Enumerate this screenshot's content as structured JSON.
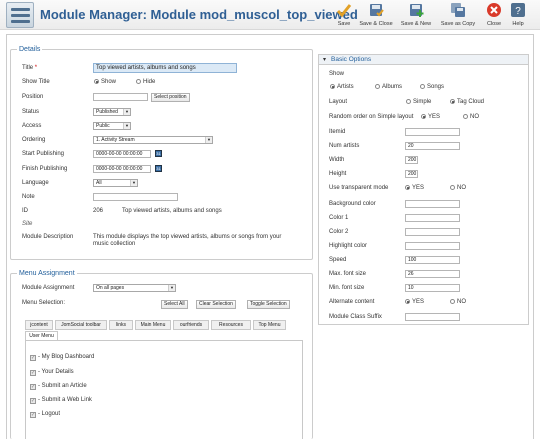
{
  "header": {
    "title": "Module Manager: Module mod_muscol_top_viewed",
    "toolbar": [
      {
        "label": "Save",
        "icon": "check-icon",
        "color": "#e2a127"
      },
      {
        "label": "Save & Close",
        "icon": "disk-check-icon",
        "color": "#5577a0"
      },
      {
        "label": "Save & New",
        "icon": "disk-plus-icon",
        "color": "#5577a0"
      },
      {
        "label": "Save as Copy",
        "icon": "disk-copy-icon",
        "color": "#5577a0"
      },
      {
        "label": "Close",
        "icon": "close-icon",
        "color": "#d93a2a"
      },
      {
        "label": "Help",
        "icon": "help-icon",
        "color": "#4f6f8f"
      }
    ]
  },
  "details": {
    "legend": "Details",
    "title_label": "Title",
    "title_required": "*",
    "title_value": "Top viewed artists, albums and songs",
    "show_title_label": "Show Title",
    "show_title_options": [
      "Show",
      "Hide"
    ],
    "position_label": "Position",
    "position_value": "",
    "select_position_button": "Select position",
    "status_label": "Status",
    "status_value": "Published",
    "access_label": "Access",
    "access_value": "Public",
    "ordering_label": "Ordering",
    "ordering_value": "1. Activity Stream",
    "start_publishing_label": "Start Publishing",
    "start_publishing_value": "0000-00-00 00:00:00",
    "finish_publishing_label": "Finish Publishing",
    "finish_publishing_value": "0000-00-00 00:00:00",
    "language_label": "Language",
    "language_value": "All",
    "note_label": "Note",
    "note_value": "",
    "id_label": "ID",
    "id_value": "206",
    "id_desc": "Top viewed artists, albums and songs",
    "site_label": "Site",
    "module_description_label": "Module Description",
    "module_description_line1": "This module displays the top viewed artists, albums or songs from your",
    "module_description_line2": "music collection"
  },
  "menu_assignment": {
    "legend": "Menu Assignment",
    "module_assignment_label": "Module Assignment",
    "module_assignment_value": "On all pages",
    "menu_selection_label": "Menu Selection:",
    "select_all": "Select All",
    "clear_selection": "Clear Selection",
    "toggle_selection": "Toggle Selection",
    "tabs": [
      "jcontent",
      "JomSocial toolbar",
      "links",
      "Main Menu",
      "ourfriends",
      "Resources",
      "Top Menu"
    ],
    "active_tab": "User Menu",
    "items": [
      "- My Blog Dashboard",
      "- Your Details",
      "- Submit an Article",
      "- Submit a Web Link",
      "- Logout"
    ]
  },
  "basic_options": {
    "legend": "Basic Options",
    "show_label": "Show",
    "show_options": [
      "Artists",
      "Albums",
      "Songs"
    ],
    "layout_label": "Layout",
    "layout_options": [
      "Simple",
      "Tag Cloud"
    ],
    "random_order_label": "Random order on Simple layout",
    "yes": "YES",
    "no": "NO",
    "itemid_label": "Itemid",
    "itemid_value": "",
    "num_artists_label": "Num artists",
    "num_artists_value": "20",
    "width_label": "Width",
    "width_value": "200",
    "height_label": "Height",
    "height_value": "200",
    "transparent_label": "Use transparent mode",
    "background_color_label": "Background color",
    "color1_label": "Color 1",
    "color2_label": "Color 2",
    "highlight_color_label": "Highlight color",
    "speed_label": "Speed",
    "speed_value": "100",
    "max_font_label": "Max. font size",
    "max_font_value": "26",
    "min_font_label": "Min. font size",
    "min_font_value": "10",
    "alternate_content_label": "Alternate content",
    "module_class_suffix_label": "Module Class Suffix"
  }
}
